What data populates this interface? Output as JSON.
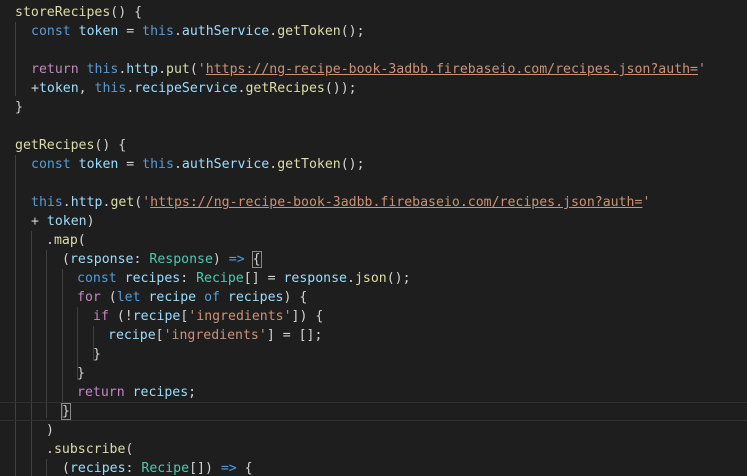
{
  "colors": {
    "background": "#1e1e1e",
    "function": "#dcdcaa",
    "keyword": "#569cd6",
    "control_keyword": "#c586c0",
    "variable": "#9cdcfe",
    "type": "#4ec9b0",
    "string": "#ce9178",
    "punctuation": "#d4d4d4"
  },
  "code": {
    "lines": [
      [
        [
          "f",
          "storeRecipes"
        ],
        [
          "p",
          "() {"
        ]
      ],
      [
        [
          "k",
          "const "
        ],
        [
          "v",
          "token"
        ],
        [
          "p",
          " = "
        ],
        [
          "k",
          "this"
        ],
        [
          "p",
          "."
        ],
        [
          "v",
          "authService"
        ],
        [
          "p",
          "."
        ],
        [
          "f",
          "getToken"
        ],
        [
          "p",
          "();"
        ]
      ],
      [],
      [
        [
          "kc",
          "return "
        ],
        [
          "k",
          "this"
        ],
        [
          "p",
          "."
        ],
        [
          "v",
          "http"
        ],
        [
          "p",
          "."
        ],
        [
          "f",
          "put"
        ],
        [
          "p",
          "("
        ],
        [
          "s",
          "'"
        ],
        [
          "su",
          "https://ng-recipe-book-3adbb.firebaseio.com/recipes.json?auth="
        ],
        [
          "s",
          "'"
        ]
      ],
      [
        [
          "p",
          "+"
        ],
        [
          "v",
          "token"
        ],
        [
          "p",
          ", "
        ],
        [
          "k",
          "this"
        ],
        [
          "p",
          "."
        ],
        [
          "v",
          "recipeService"
        ],
        [
          "p",
          "."
        ],
        [
          "f",
          "getRecipes"
        ],
        [
          "p",
          "());"
        ]
      ],
      [
        [
          "p",
          "}"
        ]
      ],
      [],
      [
        [
          "f",
          "getRecipes"
        ],
        [
          "p",
          "() {"
        ]
      ],
      [
        [
          "k",
          "const "
        ],
        [
          "v",
          "token"
        ],
        [
          "p",
          " = "
        ],
        [
          "k",
          "this"
        ],
        [
          "p",
          "."
        ],
        [
          "v",
          "authService"
        ],
        [
          "p",
          "."
        ],
        [
          "f",
          "getToken"
        ],
        [
          "p",
          "();"
        ]
      ],
      [],
      [
        [
          "k",
          "this"
        ],
        [
          "p",
          "."
        ],
        [
          "v",
          "http"
        ],
        [
          "p",
          "."
        ],
        [
          "f",
          "get"
        ],
        [
          "p",
          "("
        ],
        [
          "s",
          "'"
        ],
        [
          "su",
          "https://ng-recipe-book-3adbb.firebaseio.com/recipes.json?auth="
        ],
        [
          "s",
          "'"
        ]
      ],
      [
        [
          "p",
          "+ "
        ],
        [
          "v",
          "token"
        ],
        [
          "p",
          ")"
        ]
      ],
      [
        [
          "p",
          "."
        ],
        [
          "f",
          "map"
        ],
        [
          "p",
          "("
        ]
      ],
      [
        [
          "p",
          "("
        ],
        [
          "v",
          "response"
        ],
        [
          "p",
          ": "
        ],
        [
          "t",
          "Response"
        ],
        [
          "p",
          ") "
        ],
        [
          "k",
          "=>"
        ],
        [
          "p",
          " "
        ],
        [
          "p",
          "{"
        ]
      ],
      [
        [
          "k",
          "const "
        ],
        [
          "v",
          "recipes"
        ],
        [
          "p",
          ": "
        ],
        [
          "t",
          "Recipe"
        ],
        [
          "p",
          "[] = "
        ],
        [
          "v",
          "response"
        ],
        [
          "p",
          "."
        ],
        [
          "f",
          "json"
        ],
        [
          "p",
          "();"
        ]
      ],
      [
        [
          "kc",
          "for "
        ],
        [
          "p",
          "("
        ],
        [
          "k",
          "let "
        ],
        [
          "v",
          "recipe"
        ],
        [
          "p",
          " "
        ],
        [
          "k",
          "of "
        ],
        [
          "v",
          "recipes"
        ],
        [
          "p",
          ") {"
        ]
      ],
      [
        [
          "kc",
          "if "
        ],
        [
          "p",
          "(!"
        ],
        [
          "v",
          "recipe"
        ],
        [
          "p",
          "["
        ],
        [
          "s",
          "'ingredients'"
        ],
        [
          "p",
          "]) {"
        ]
      ],
      [
        [
          "v",
          "recipe"
        ],
        [
          "p",
          "["
        ],
        [
          "s",
          "'ingredients'"
        ],
        [
          "p",
          "] = [];"
        ]
      ],
      [
        [
          "p",
          "}"
        ]
      ],
      [
        [
          "p",
          "}"
        ]
      ],
      [
        [
          "kc",
          "return "
        ],
        [
          "v",
          "recipes"
        ],
        [
          "p",
          ";"
        ]
      ],
      [
        [
          "p",
          "}"
        ]
      ],
      [
        [
          "p",
          ")"
        ]
      ],
      [
        [
          "p",
          "."
        ],
        [
          "f",
          "subscribe"
        ],
        [
          "p",
          "("
        ]
      ],
      [
        [
          "p",
          "("
        ],
        [
          "v",
          "recipes"
        ],
        [
          "p",
          ": "
        ],
        [
          "t",
          "Recipe"
        ],
        [
          "p",
          "[]) "
        ],
        [
          "k",
          "=>"
        ],
        [
          "p",
          " {"
        ]
      ]
    ]
  }
}
